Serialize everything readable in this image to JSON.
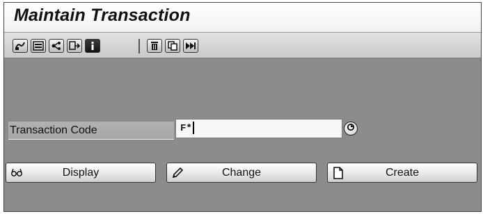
{
  "window": {
    "title": "Maintain Transaction"
  },
  "toolbar": {
    "buttons": [
      {
        "name": "test-transaction-icon"
      },
      {
        "name": "display-object-list-icon"
      },
      {
        "name": "where-used-list-icon"
      },
      {
        "name": "other-object-icon"
      },
      {
        "name": "info-icon"
      },
      {
        "name": "delete-icon"
      },
      {
        "name": "copy-icon"
      },
      {
        "name": "variants-icon"
      }
    ]
  },
  "form": {
    "transaction_code_label": "Transaction Code",
    "transaction_code_value": "F*"
  },
  "actions": {
    "display_label": "Display",
    "change_label": "Change",
    "create_label": "Create"
  }
}
